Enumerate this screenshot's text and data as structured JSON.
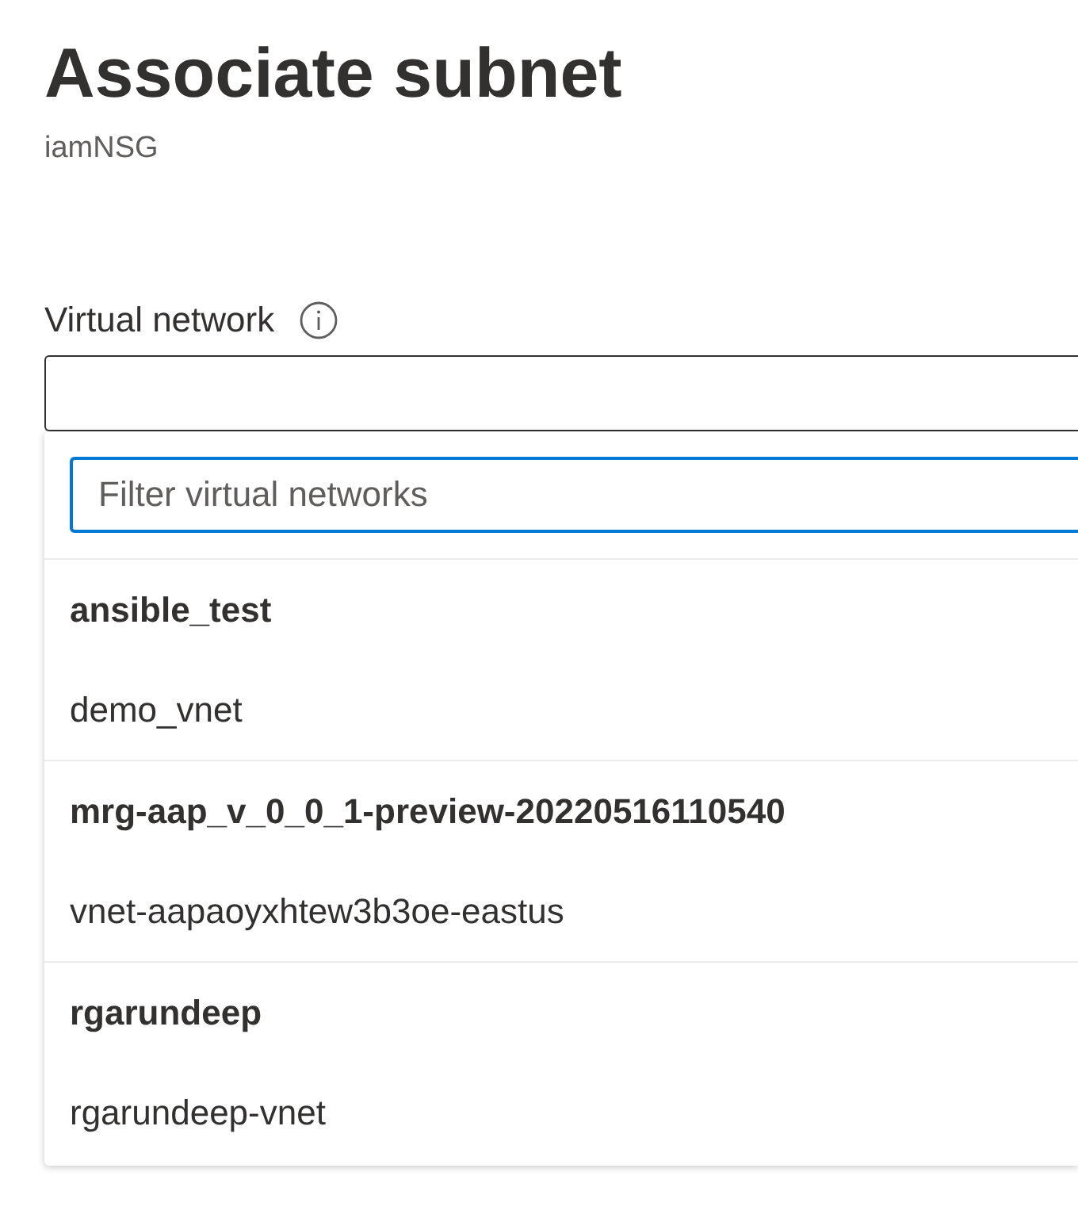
{
  "panel": {
    "title": "Associate subnet",
    "subtitle": "iamNSG"
  },
  "field": {
    "label": "Virtual network",
    "expanded": true
  },
  "dropdown": {
    "filter": {
      "placeholder": "Filter virtual networks",
      "focused": true
    },
    "groups": [
      {
        "name": "ansible_test",
        "items": [
          {
            "label": "demo_vnet",
            "selected": false
          }
        ]
      },
      {
        "name": "mrg-aap_v_0_0_1-preview-20220516110540",
        "items": [
          {
            "label": "vnet-aapaoyxhtew3b3oe-eastus",
            "selected": false
          }
        ]
      },
      {
        "name": "rgarundeep",
        "items": [
          {
            "label": "rgarundeep-vnet",
            "selected": false
          }
        ]
      }
    ]
  }
}
